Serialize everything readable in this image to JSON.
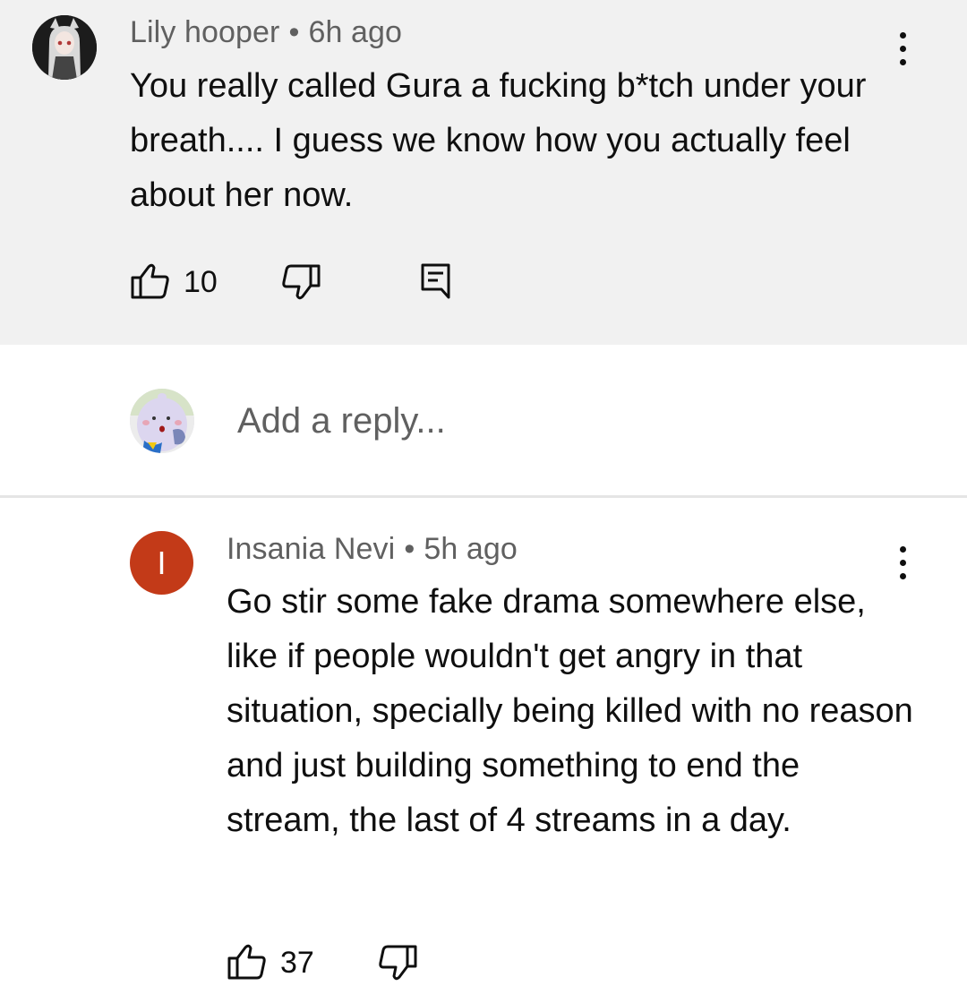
{
  "comment": {
    "author": "Lily hooper",
    "time": "6h ago",
    "text": "You really called Gura a fucking b*tch under your breath.... I guess we know how you actually feel about her now.",
    "likes": "10"
  },
  "reply_box": {
    "placeholder": "Add a reply..."
  },
  "reply": {
    "avatar_letter": "I",
    "author": "Insania Nevi",
    "time": "5h ago",
    "text": "Go stir some fake drama somewhere else, like if people wouldn't get angry in that situation, specially being killed with no reason and just building something to end the stream, the last of 4 streams in a day.",
    "likes": "37"
  },
  "separator": "•",
  "colors": {
    "parent_bg": "#f1f1f1",
    "reply_avatar_bg": "#c33a18",
    "meta_text": "#606060"
  },
  "icons": [
    "thumb-up-icon",
    "thumb-down-icon",
    "reply-comment-icon",
    "more-vert-icon"
  ]
}
